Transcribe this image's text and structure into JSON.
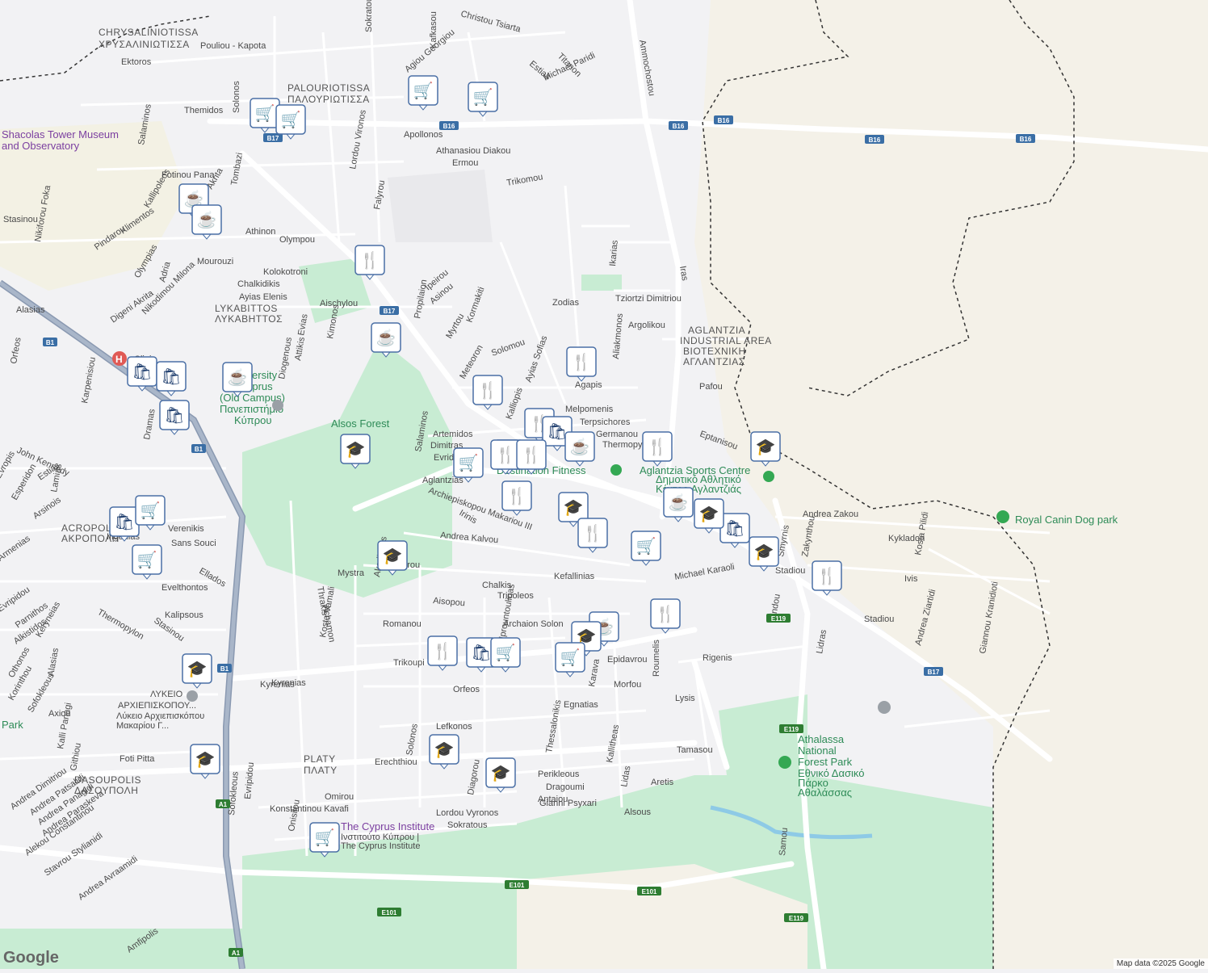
{
  "attribution": "Map data ©2025 Google",
  "logo": "Google",
  "colors": {
    "background": "#f2f2f4",
    "park": "#c8ecd3",
    "hill": "#f4f1e8",
    "road": "#ffffff",
    "highway": "#8a99b1",
    "border": "#333333",
    "pin": "#1a3a6b"
  },
  "districts": [
    {
      "id": "chrysaliniotissa",
      "text": "CHRYSALINIOTISSA"
    },
    {
      "id": "chrysaliniotissa-gr",
      "text": "ΧΡΥΣΑΛΙΝΙΩΤΙΣΣΑ"
    },
    {
      "id": "palouriotissa",
      "text": "PALOURIOTISSA"
    },
    {
      "id": "palouriotissa-gr",
      "text": "ΠΑΛΟΥΡΙΩΤΙΣΣΑ"
    },
    {
      "id": "lykavittos",
      "text": "LYKABITTOS"
    },
    {
      "id": "lykavittos-gr",
      "text": "ΛΥΚΑΒΗΤΤΟΣ"
    },
    {
      "id": "aglantzia-ind",
      "text": "AGLANTZIA"
    },
    {
      "id": "aglantzia-ind2",
      "text": "INDUSTRIAL AREA"
    },
    {
      "id": "aglantzia-ind3",
      "text": "ΒΙΟΤΕΧΝΙΚΗ"
    },
    {
      "id": "aglantzia-ind4",
      "text": "ΑΓΛΑΝΤΖΙΑΣ"
    },
    {
      "id": "acropolis",
      "text": "ACROPOLIS"
    },
    {
      "id": "acropolis-gr",
      "text": "ΑΚΡΟΠΟΛΗ"
    },
    {
      "id": "dasoupolis",
      "text": "DASOUPOLIS"
    },
    {
      "id": "dasoupolis-gr",
      "text": "ΔΑΣΟΥΠΟΛΗ"
    },
    {
      "id": "platy",
      "text": "PLATY"
    },
    {
      "id": "platy-gr",
      "text": "ΠΛΑΤΥ"
    }
  ],
  "pois": [
    {
      "id": "shacolas",
      "text": "Shacolas Tower Museum"
    },
    {
      "id": "shacolas2",
      "text": "and Observatory"
    },
    {
      "id": "alsos",
      "text": "Alsos Forest"
    },
    {
      "id": "ucy",
      "text": "University"
    },
    {
      "id": "ucy2",
      "text": "of Cyprus"
    },
    {
      "id": "ucy3",
      "text": "(Old Campus)"
    },
    {
      "id": "ucy4",
      "text": "Πανεπιστήμιο"
    },
    {
      "id": "ucy5",
      "text": "Κύπρου"
    },
    {
      "id": "fitness",
      "text": "Destination Fitness"
    },
    {
      "id": "sports",
      "text": "Aglantzia Sports Centre"
    },
    {
      "id": "sports2",
      "text": "Δημοτικό Αθλητικό"
    },
    {
      "id": "sports3",
      "text": "Κέντρο Αγλαντζιάς"
    },
    {
      "id": "royal",
      "text": "Royal Canin Dog park"
    },
    {
      "id": "athalassa",
      "text": "Athalassa"
    },
    {
      "id": "athalassa2",
      "text": "National"
    },
    {
      "id": "athalassa3",
      "text": "Forest Park"
    },
    {
      "id": "athalassa4",
      "text": "Εθνικό Δασικό"
    },
    {
      "id": "athalassa5",
      "text": "Πάρκο"
    },
    {
      "id": "athalassa6",
      "text": "Αθαλάσσας"
    },
    {
      "id": "cyi",
      "text": "The Cyprus Institute"
    },
    {
      "id": "cyi2",
      "text": "Ινστιτούτο Κύπρου |"
    },
    {
      "id": "cyi3",
      "text": "The Cyprus Institute"
    },
    {
      "id": "lykeio",
      "text": "ΛΥΚΕΙΟ"
    },
    {
      "id": "lykeio2",
      "text": "ΑΡΧΙΕΠΙΣΚΟΠΟΥ..."
    },
    {
      "id": "lykeio3",
      "text": "Λύκειο Αρχιεπισκόπου"
    },
    {
      "id": "lykeio4",
      "text": "Μακαρίου Γ..."
    },
    {
      "id": "clinic",
      "text": "Clinic"
    },
    {
      "id": "park",
      "text": "Park"
    }
  ],
  "streets": [
    "Pouliou - Kapota",
    "Ektoros",
    "Themidos",
    "Solonos",
    "Sokratous",
    "Kafkasou",
    "Christou Tsiarta",
    "Titanon",
    "Estias",
    "Michael Paridi",
    "Agiou Georgiou",
    "Apollonos",
    "Athanasiou Diakou",
    "Ermou",
    "Trikomou",
    "Lordou Vironos",
    "Falyrou",
    "Fotinou Pana",
    "Akrita",
    "Tombazi",
    "Stasinou",
    "Pindarou",
    "Klimentos",
    "Athinon",
    "Olympou",
    "Mourouzi",
    "Kolokotroni",
    "Chalkidikis",
    "Ayias Elenis",
    "Aischylou",
    "Kimonos",
    "Evias",
    "Diogenous",
    "Attikis",
    "Propilaion",
    "Ipeirou",
    "Asinou",
    "Myrtou",
    "Kormakiti",
    "Zodias",
    "Tziortzi Dimitriou",
    "Argolikou",
    "Ikarias",
    "Aliakmonos",
    "Meteoron",
    "Solomou",
    "Ayias Sofias",
    "Kalliopis",
    "Agapis",
    "Melpomenis",
    "Terpsichores",
    "Germanou",
    "Thermopylon",
    "Pafou",
    "Eptanisou",
    "Artemidos",
    "Dimitras",
    "Evridikis",
    "Salaminos",
    "Aglantzias",
    "Archiepiskopou Makariou III",
    "Irinis",
    "Andrea Kalvou",
    "Kefallinias",
    "Michael Karaoli",
    "Chalkis",
    "Tripoleos",
    "Aisopou",
    "Romanou",
    "Archaion Solon",
    "Kentavrou",
    "Mystra",
    "Thrakis",
    "Kosta Vamali",
    "Achamon",
    "Akadimias",
    "Kyrenias",
    "Orfeos",
    "Egnatias",
    "Morfou",
    "Epidavrou",
    "Rigenis",
    "Lysis",
    "Roumelis",
    "Karava",
    "Trikoupi",
    "Thessalonikis",
    "Lefkonos",
    "Solonos",
    "Erechthiou",
    "Diagorou",
    "Mprountoulinas",
    "Perikleous",
    "Dragoumi",
    "Antaiou",
    "Gianni Psyxari",
    "Lordou Vyronos",
    "Sokratous",
    "Kallitheas",
    "Lidas",
    "Aretis",
    "Alsous",
    "Tamasou",
    "Omirou",
    "Konstantinou Kavafi",
    "Onisilou",
    "Andrea Dimitriou",
    "Andrea Patsalidi",
    "Andrea Panagidi",
    "Andrea Paraskeva",
    "Alekou Constantinou",
    "Stavrou Stylianidi",
    "Andrea Avraamidi",
    "Amfipolis",
    "Foti Pitta",
    "Kalli Panagi",
    "Githiou",
    "Sofokleous",
    "Evripidou",
    "Kyrenias",
    "Axiou",
    "Korinthou",
    "Sofokleous",
    "Alasias",
    "Keryneias",
    "Othonos",
    "Parnithos",
    "Alkistidos",
    "Evripidou",
    "Thermopylon",
    "Kalipsous",
    "Stasinou",
    "Evelthontos",
    "Ellados",
    "Sans Souci",
    "Ifigenias",
    "Verenikis",
    "Armenias",
    "Arsinois",
    "Lamias",
    "Estias",
    "Esperidon",
    "Evropis",
    "John Kennedy",
    "Dramas",
    "Karpenisiou",
    "Orfeos",
    "Alasias",
    "Digeni Akrita",
    "Nikodimou Milona",
    "Olympias",
    "Adria",
    "Kallipoleos",
    "Salaminos",
    "Nikiforou Foka",
    "Iras",
    "Ammochostou",
    "Andrea Zakou",
    "Kykladon",
    "Kosta Pilidi",
    "Ivis",
    "Stadiou",
    "Stadiou",
    "Andrea Ziartidi",
    "Giannou Kranidioti",
    "Lidras",
    "Pindou",
    "Smyrnis",
    "Zakynthou",
    "Samou",
    "Athalassas"
  ],
  "route_shields": [
    "B16",
    "B16",
    "B16",
    "B16",
    "B16",
    "B17",
    "B17",
    "B17",
    "B1",
    "B1",
    "B1",
    "A1",
    "A1",
    "E101",
    "E101",
    "E101",
    "E119",
    "E119",
    "E119"
  ],
  "markers": [
    {
      "kind": "shopping-cart"
    },
    {
      "kind": "shopping-cart"
    },
    {
      "kind": "shopping-cart"
    },
    {
      "kind": "shopping-cart"
    },
    {
      "kind": "cafe"
    },
    {
      "kind": "cafe"
    },
    {
      "kind": "restaurant"
    },
    {
      "kind": "cafe"
    },
    {
      "kind": "shopping-bag"
    },
    {
      "kind": "shopping-bag"
    },
    {
      "kind": "cafe"
    },
    {
      "kind": "shopping-bag"
    },
    {
      "kind": "restaurant"
    },
    {
      "kind": "restaurant"
    },
    {
      "kind": "restaurant"
    },
    {
      "kind": "shopping-bag"
    },
    {
      "kind": "cafe"
    },
    {
      "kind": "restaurant"
    },
    {
      "kind": "restaurant"
    },
    {
      "kind": "shopping-cart"
    },
    {
      "kind": "school"
    },
    {
      "kind": "restaurant"
    },
    {
      "kind": "school"
    },
    {
      "kind": "restaurant"
    },
    {
      "kind": "restaurant"
    },
    {
      "kind": "school"
    },
    {
      "kind": "school"
    },
    {
      "kind": "shopping-bag"
    },
    {
      "kind": "cafe"
    },
    {
      "kind": "school"
    },
    {
      "kind": "restaurant"
    },
    {
      "kind": "shopping-cart"
    },
    {
      "kind": "school"
    },
    {
      "kind": "restaurant"
    },
    {
      "kind": "cafe"
    },
    {
      "kind": "school"
    },
    {
      "kind": "restaurant"
    },
    {
      "kind": "shopping-bag"
    },
    {
      "kind": "shopping-cart"
    },
    {
      "kind": "shopping-cart"
    },
    {
      "kind": "school"
    },
    {
      "kind": "school"
    },
    {
      "kind": "school"
    },
    {
      "kind": "school"
    },
    {
      "kind": "shopping-cart"
    },
    {
      "kind": "shopping-cart"
    },
    {
      "kind": "shopping-bag"
    },
    {
      "kind": "shopping-cart"
    },
    {
      "kind": "restaurant"
    }
  ]
}
